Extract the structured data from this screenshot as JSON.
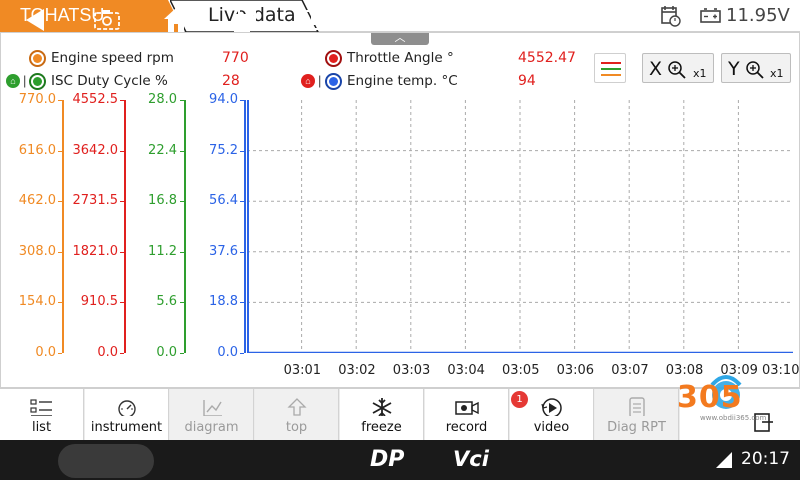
{
  "header": {
    "brand": "TOHATSU",
    "title": "Live data",
    "voltage": "11.95V",
    "brand_color": "#f08a24"
  },
  "params": [
    {
      "label": "Engine speed  rpm",
      "value": "770",
      "color": "#f08a24"
    },
    {
      "label": "ISC Duty Cycle  %",
      "value": "28",
      "color": "#2e9e2e"
    },
    {
      "label": "Throttle Angle  °",
      "value": "4552.47",
      "color": "#e0201e"
    },
    {
      "label": "Engine temp.  °C",
      "value": "94",
      "color": "#2b63e6"
    }
  ],
  "tools": {
    "x_zoom": {
      "axis": "X",
      "scale": "x1"
    },
    "y_zoom": {
      "axis": "Y",
      "scale": "x1"
    }
  },
  "chart_data": {
    "type": "line",
    "x_ticks": [
      "03:01",
      "03:02",
      "03:03",
      "03:04",
      "03:05",
      "03:06",
      "03:07",
      "03:08",
      "03:09",
      "03:10"
    ],
    "y_axes": [
      {
        "series": "Engine speed  rpm",
        "color": "#f08a24",
        "ticks": [
          "770.0",
          "616.0",
          "462.0",
          "308.0",
          "154.0",
          "0.0"
        ],
        "ylim": [
          0,
          770
        ]
      },
      {
        "series": "Throttle Angle  °",
        "color": "#e0201e",
        "ticks": [
          "4552.5",
          "3642.0",
          "2731.5",
          "1821.0",
          "910.5",
          "0.0"
        ],
        "ylim": [
          0,
          4552.5
        ]
      },
      {
        "series": "ISC Duty Cycle  %",
        "color": "#2e9e2e",
        "ticks": [
          "28.0",
          "22.4",
          "16.8",
          "11.2",
          "5.6",
          "0.0"
        ],
        "ylim": [
          0,
          28
        ]
      },
      {
        "series": "Engine temp.  °C",
        "color": "#2b63e6",
        "ticks": [
          "94.0",
          "75.2",
          "56.4",
          "37.6",
          "18.8",
          "0.0"
        ],
        "ylim": [
          0,
          94
        ]
      }
    ],
    "grid": true
  },
  "toolbar": [
    {
      "label": "list",
      "icon": "list-icon",
      "enabled": true
    },
    {
      "label": "instrument",
      "icon": "gauge-icon",
      "enabled": true
    },
    {
      "label": "diagram",
      "icon": "diagram-icon",
      "enabled": false
    },
    {
      "label": "top",
      "icon": "arrow-up-icon",
      "enabled": false
    },
    {
      "label": "freeze",
      "icon": "snowflake-icon",
      "enabled": true
    },
    {
      "label": "record",
      "icon": "camera-icon",
      "enabled": true
    },
    {
      "label": "video",
      "icon": "play-icon",
      "enabled": true,
      "badge": "1"
    },
    {
      "label": "Diag RPT",
      "icon": "report-icon",
      "enabled": false
    }
  ],
  "system": {
    "time": "20:17",
    "nav_labels": {
      "dp": "DP",
      "vci": "Vci"
    }
  },
  "watermark": {
    "text": "305",
    "url": "www.obdii365.com"
  }
}
